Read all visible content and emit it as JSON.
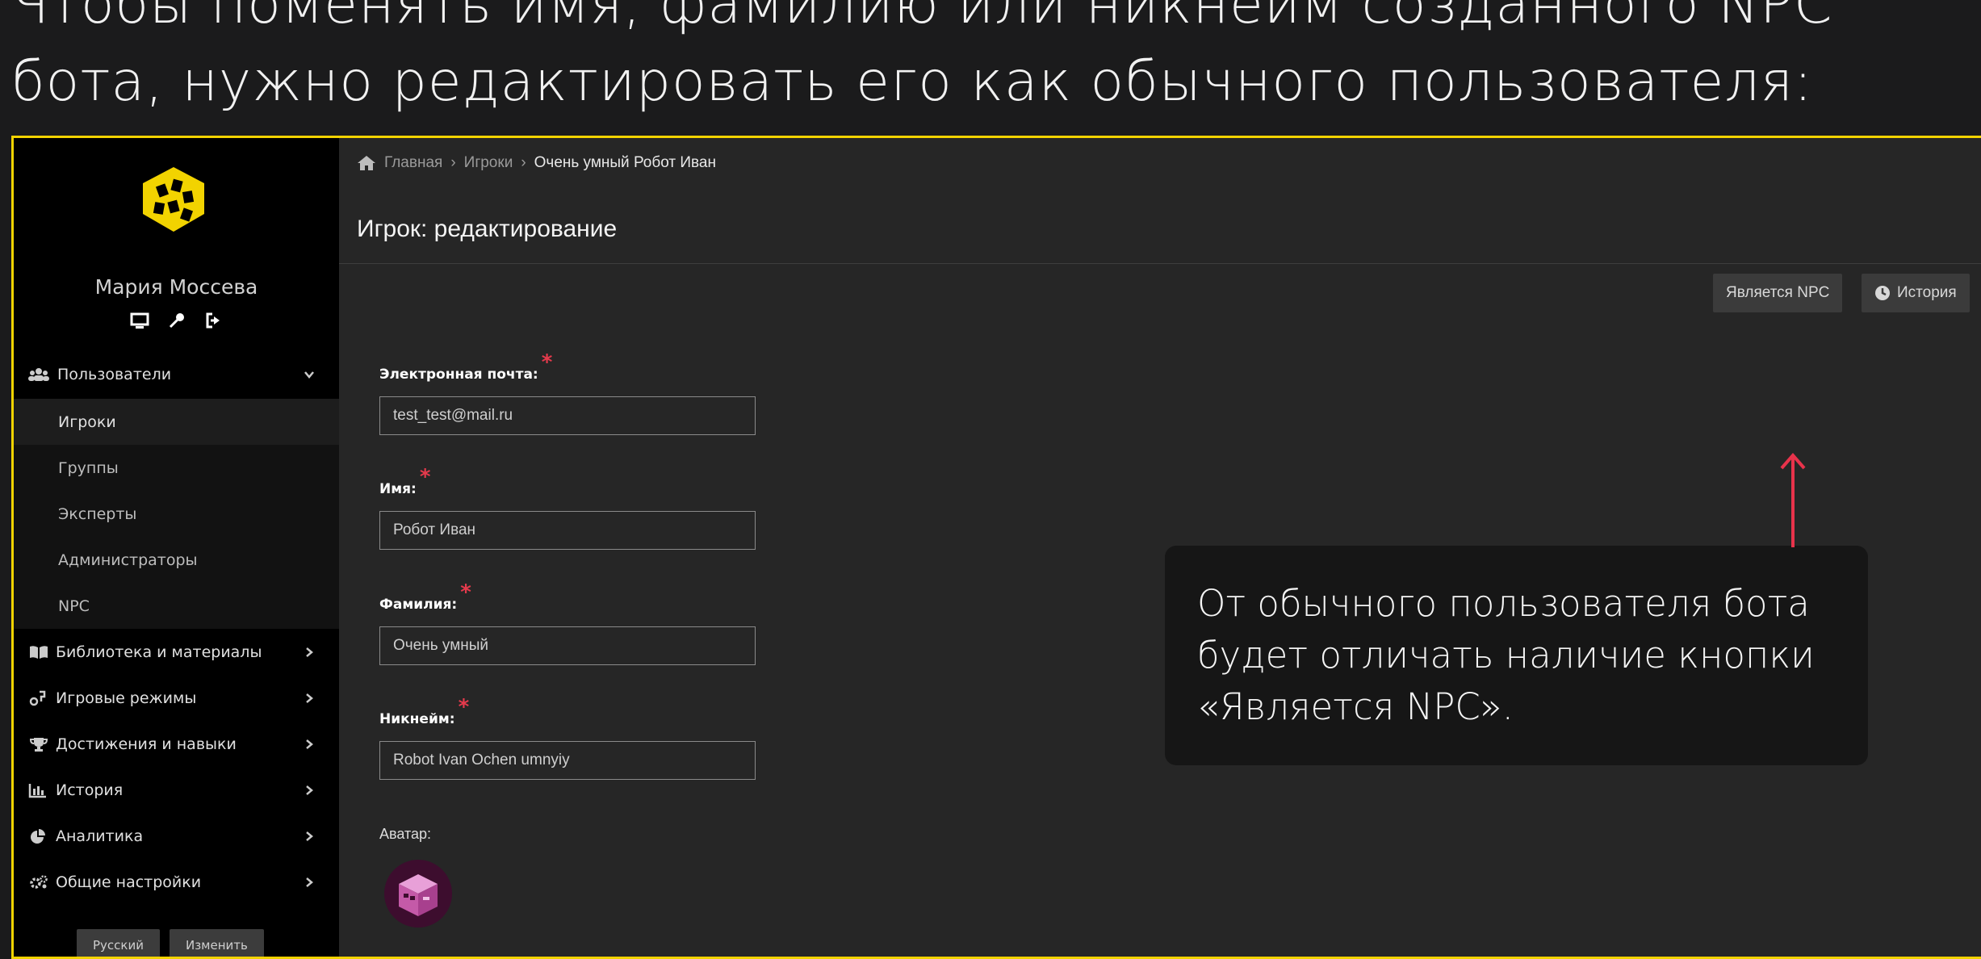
{
  "slide": {
    "title": "Чтобы поменять имя, фамилию или никнейм созданного NPC бота, нужно редактировать его как обычного пользователя:"
  },
  "sidebar": {
    "user_name": "Мария Моссева",
    "users_section": "Пользователи",
    "subitems": [
      {
        "label": "Игроки",
        "active": true
      },
      {
        "label": "Группы"
      },
      {
        "label": "Эксперты"
      },
      {
        "label": "Администраторы"
      },
      {
        "label": "NPC"
      }
    ],
    "items": [
      {
        "label": "Библиотека и материалы",
        "icon": "book-icon"
      },
      {
        "label": "Игровые режимы",
        "icon": "gamepad-icon"
      },
      {
        "label": "Достижения и навыки",
        "icon": "trophy-icon"
      },
      {
        "label": "История",
        "icon": "chart-icon"
      },
      {
        "label": "Аналитика",
        "icon": "pie-icon"
      },
      {
        "label": "Общие настройки",
        "icon": "gears-icon"
      }
    ],
    "language_select": "Русский",
    "change_button": "Изменить"
  },
  "breadcrumb": {
    "home": "Главная",
    "section": "Игроки",
    "current": "Очень умный Робот Иван"
  },
  "page": {
    "title": "Игрок: редактирование",
    "npc_button": "Является NPC",
    "history_button": "История"
  },
  "form": {
    "email_label": "Электронная почта:",
    "email_value": "test_test@mail.ru",
    "first_name_label": "Имя:",
    "first_name_value": "Робот Иван",
    "last_name_label": "Фамилия:",
    "last_name_value": "Очень умный",
    "nickname_label": "Никнейм:",
    "nickname_value": "Robot Ivan Ochen umnyiy",
    "avatar_label": "Аватар:",
    "required_mark": "*"
  },
  "callout": {
    "text": "От обычного пользователя бота будет отличать наличие кнопки «Является NPC»."
  },
  "colors": {
    "accent_yellow": "#f2d300",
    "required_red": "#e53a4c",
    "arrow_red": "#e8334b"
  }
}
